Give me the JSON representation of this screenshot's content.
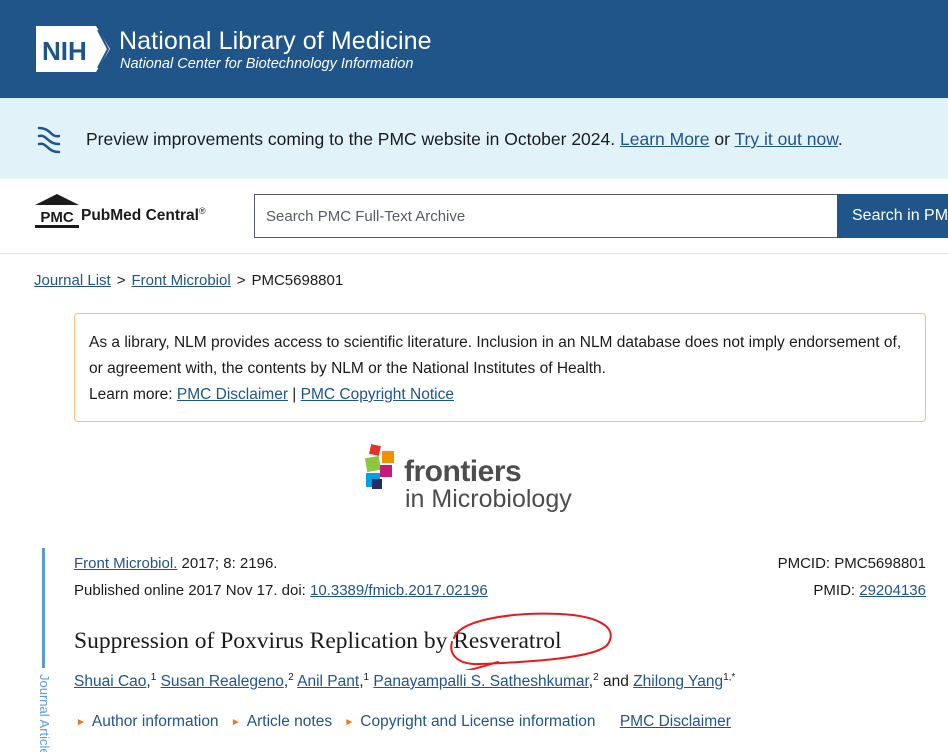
{
  "header": {
    "logo_text": "NIH",
    "title": "National Library of Medicine",
    "subtitle": "National Center for Biotechnology Information",
    "bg_color": "#20558a"
  },
  "banner": {
    "icon": "dna-helix-icon",
    "text_before": "Preview improvements coming to the PMC website in October 2024.",
    "learn_more": "Learn More",
    "or": "or",
    "try_it": "Try it out now",
    "period": "."
  },
  "pmc": {
    "logo_mark": "PMC",
    "logo_name": "PubMed Central",
    "reg": "®",
    "search_placeholder": "Search PMC Full-Text Archive",
    "search_button": "Search in PMC"
  },
  "breadcrumb": {
    "items": [
      "Journal List",
      "Front Microbiol",
      "PMC5698801"
    ],
    "separator": ">"
  },
  "disclaimer": {
    "line1": "As a library, NLM provides access to scientific literature. Inclusion in an NLM database does not imply endorsement of, or agreement with, the contents by NLM or the National Institutes of Health.",
    "learn_more_label": "Learn more:",
    "link1": "PMC Disclaimer",
    "divider": "|",
    "link2": "PMC Copyright Notice"
  },
  "journal_logo": {
    "line1": "frontiers",
    "line2": "in Microbiology"
  },
  "side_tab": {
    "label": "Journal Article"
  },
  "citation": {
    "journal": "Front Microbiol.",
    "year_vol": "2017; 8: 2196.",
    "published": "Published online 2017 Nov 17. doi:",
    "doi": "10.3389/fmicb.2017.02196",
    "pmcid_label": "PMCID: PMC5698801",
    "pmid_label": "PMID:",
    "pmid": "29204136"
  },
  "article": {
    "title": "Suppression of Poxvirus Replication by Resveratrol",
    "authors": [
      {
        "name": "Shuai Cao",
        "sup": "1"
      },
      {
        "name": "Susan Realegeno",
        "sup": "2"
      },
      {
        "name": "Anil Pant",
        "sup": "1"
      },
      {
        "name": "Panayampalli S. Satheshkumar",
        "sup": "2"
      },
      {
        "name": "Zhilong Yang",
        "sup": "1,*"
      }
    ],
    "and": "and"
  },
  "info_links": {
    "author_info": "Author information",
    "article_notes": "Article notes",
    "copyright": "Copyright and License information",
    "pmc_disclaimer": "PMC Disclaimer"
  }
}
